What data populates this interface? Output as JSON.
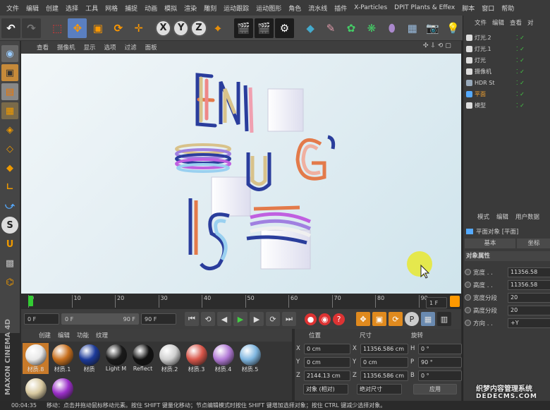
{
  "menu": [
    "文件",
    "编辑",
    "创建",
    "选择",
    "工具",
    "网格",
    "捕捉",
    "动画",
    "模拟",
    "渲染",
    "雕刻",
    "运动跟踪",
    "运动图形",
    "角色",
    "流水线",
    "插件",
    "X-Particles",
    "DPIT Plants & Effex",
    "脚本",
    "窗口",
    "帮助"
  ],
  "toolbar": {
    "x": "X",
    "y": "Y",
    "z": "Z"
  },
  "viewport_menu": [
    "查看",
    "摄像机",
    "显示",
    "选项",
    "过滤",
    "面板"
  ],
  "timeline_ticks": [
    "0",
    "10",
    "20",
    "30",
    "40",
    "50",
    "60",
    "70",
    "80",
    "90"
  ],
  "timeline_end": "1 F",
  "playbar": {
    "start": "0 F",
    "min": "0 F",
    "max": "90 F",
    "end": "90 F"
  },
  "material_menu": [
    "创建",
    "编辑",
    "功能",
    "纹理"
  ],
  "materials": [
    {
      "label": "材质.8",
      "color": "#e8e8e8",
      "sel": true
    },
    {
      "label": "材质.1",
      "color": "#c8701e"
    },
    {
      "label": "材质",
      "color": "#1c3a9a"
    },
    {
      "label": "Light M",
      "color": "#1a1a1a"
    },
    {
      "label": "Reflect",
      "color": "#111111"
    },
    {
      "label": "材质.2",
      "color": "#cfcfcf"
    },
    {
      "label": "材质.3",
      "color": "#d8564a"
    },
    {
      "label": "材质.4",
      "color": "#b27ad6"
    },
    {
      "label": "材质.5",
      "color": "#7fb6e0"
    },
    {
      "label": "",
      "color": "#d8c9a0"
    },
    {
      "label": "",
      "color": "#9a2fc8"
    }
  ],
  "coords": {
    "headers": [
      "位置",
      "尺寸",
      "旋转"
    ],
    "rows": [
      {
        "axis": "X",
        "pos": "0 cm",
        "size": "11356.586 cm",
        "rl": "H",
        "rot": "0 °"
      },
      {
        "axis": "Y",
        "pos": "0 cm",
        "size": "0 cm",
        "rl": "P",
        "rot": "90 °"
      },
      {
        "axis": "Z",
        "pos": "2144.13 cm",
        "size": "11356.586 cm",
        "rl": "B",
        "rot": "0 °"
      }
    ],
    "mode": "对象 (相对)",
    "sizemode": "绝对尺寸",
    "apply": "应用"
  },
  "objmgr": {
    "tabs": [
      "文件",
      "编辑",
      "查看",
      "对"
    ],
    "items": [
      {
        "name": "灯光.2",
        "color": "#ddd"
      },
      {
        "name": "灯光.1",
        "color": "#ddd"
      },
      {
        "name": "灯光",
        "color": "#ddd"
      },
      {
        "name": "摄像机",
        "color": "#ddd"
      },
      {
        "name": "HDR St",
        "color": "#9ab"
      },
      {
        "name": "平面",
        "color": "#5af",
        "sel": true
      },
      {
        "name": "模型",
        "color": "#ddd"
      }
    ]
  },
  "attr": {
    "tabs": [
      "模式",
      "编辑",
      "用户数据"
    ],
    "title": "平面对象 [平面]",
    "subtabs": [
      "基本",
      "坐标"
    ],
    "section": "对象属性",
    "fields": [
      {
        "label": "宽度 . .",
        "value": "11356.58"
      },
      {
        "label": "高度 . .",
        "value": "11356.58"
      },
      {
        "label": "宽度分段",
        "value": "20"
      },
      {
        "label": "高度分段",
        "value": "20"
      },
      {
        "label": "方向 . .",
        "value": "+Y"
      }
    ]
  },
  "status": {
    "time": "00:04:35",
    "text": "移动：点击并拖动鼠标移动元素。按住 SHIFT 键量化移动；节点编辑模式时按住 SHIFT 键增加选择对象；按住 CTRL 键减少选择对象。"
  },
  "brand": "MAXON CINEMA 4D",
  "watermark": {
    "line1": "织梦内容管理系统",
    "line2": "DEDECMS.COM"
  }
}
